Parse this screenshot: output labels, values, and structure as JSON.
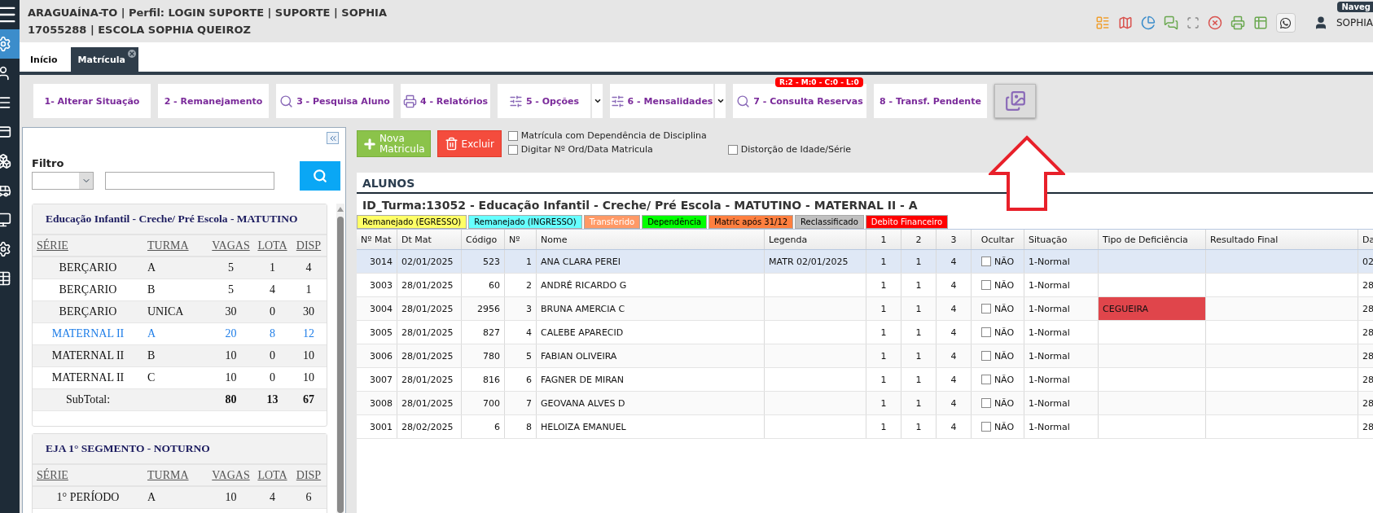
{
  "header": {
    "line1": "ARAGUAÍNA-TO | Perfil: LOGIN SUPORTE | SUPORTE | SOPHIA",
    "line2": "17055288 | ESCOLA SOPHIA QUEIROZ",
    "user": "SOPHIA",
    "badge": "Naveg"
  },
  "sidebar": {
    "items": [
      {
        "selected": true
      },
      {
        "selected": false
      },
      {
        "selected": false
      },
      {
        "selected": false
      },
      {
        "selected": false
      },
      {
        "selected": false
      },
      {
        "selected": false
      },
      {
        "selected": false
      },
      {
        "selected": false
      }
    ]
  },
  "tabs": [
    {
      "label": "Início",
      "selected": false,
      "closable": false
    },
    {
      "label": "Matrícula",
      "selected": true,
      "closable": true
    }
  ],
  "toolbar": {
    "buttons": [
      {
        "kind": "text",
        "label": "1- Alterar Situação"
      },
      {
        "kind": "text",
        "label": "2 - Remanejamento"
      },
      {
        "kind": "text",
        "label": "3 - Pesquisa Aluno"
      },
      {
        "kind": "text",
        "label": "4 - Relatórios"
      },
      {
        "kind": "text",
        "label": "5 - Opções",
        "dropdown": true
      },
      {
        "kind": "text",
        "label": "6 - Mensalidades",
        "dropdown": true
      },
      {
        "kind": "text",
        "label": "7 - Consulta Reservas",
        "badge": "R:2 - M:0 - C:0 - L:0"
      },
      {
        "kind": "text",
        "label": "8 - Transf. Pendente"
      },
      {
        "kind": "icon"
      }
    ]
  },
  "filter": {
    "label": "Filtro"
  },
  "groups": [
    {
      "title": "Educação Infantil - Creche/ Pré Escola - MATUTINO",
      "columns": [
        "SÉRIE",
        "TURMA",
        "VAGAS",
        "LOTA",
        "DISP"
      ],
      "rows": [
        {
          "selected": false,
          "cells": [
            "BERÇARIO",
            "A",
            "5",
            "1",
            "4"
          ]
        },
        {
          "selected": false,
          "cells": [
            "BERÇARIO",
            "B",
            "5",
            "4",
            "1"
          ]
        },
        {
          "selected": false,
          "cells": [
            "BERÇARIO",
            "UNICA",
            "30",
            "0",
            "30"
          ]
        },
        {
          "selected": true,
          "cells": [
            "MATERNAL II",
            "A",
            "20",
            "8",
            "12"
          ]
        },
        {
          "selected": false,
          "cells": [
            "MATERNAL II",
            "B",
            "10",
            "0",
            "10"
          ]
        },
        {
          "selected": false,
          "cells": [
            "MATERNAL II",
            "C",
            "10",
            "0",
            "10"
          ]
        }
      ],
      "subtotal": {
        "label": "SubTotal:",
        "values": [
          "80",
          "13",
          "67"
        ]
      }
    },
    {
      "title": "EJA 1° SEGMENTO - NOTURNO",
      "columns": [
        "SÉRIE",
        "TURMA",
        "VAGAS",
        "LOTA",
        "DISP"
      ],
      "rows": [
        {
          "selected": false,
          "cells": [
            "1° PERÍODO",
            "A",
            "10",
            "4",
            "6"
          ]
        }
      ]
    }
  ],
  "actions": {
    "new_label": "Nova\nMatricula",
    "delete_label": "Excluir",
    "checkboxes": [
      {
        "label": "Matrícula com Dependência de Disciplina",
        "checked": false
      },
      {
        "label": "Digitar Nº Ord/Data Matricula",
        "checked": false
      },
      {
        "label": "Distorção de Idade/Série",
        "checked": false
      }
    ]
  },
  "students": {
    "title": "ALUNOS",
    "class_title": "ID_Turma:13052 - Educação Infantil - Creche/ Pré Escola - MATUTINO - MATERNAL II - A",
    "legend": [
      {
        "label": "Remanejado (EGRESSO)",
        "color": "#ffff66"
      },
      {
        "label": "Remanejado (INGRESSO)",
        "color": "#66ffff"
      },
      {
        "label": "Transferido",
        "color": "#ff9966"
      },
      {
        "label": "Dependência",
        "color": "#00ff00"
      },
      {
        "label": "Matric após 31/12",
        "color": "#ff7f3f"
      },
      {
        "label": "Reclassificado",
        "color": "#c0c0c0"
      },
      {
        "label": "Debito Financeiro",
        "color": "#ff0000"
      }
    ],
    "columns": [
      "Nº Mat",
      "Dt Mat",
      "Código",
      "Nº",
      "Nome",
      "Legenda",
      "1",
      "2",
      "3",
      "Ocultar",
      "Situação",
      "Tipo de Deficiência",
      "Resultado Final",
      "Da"
    ],
    "rows": [
      {
        "selected": true,
        "cells": [
          "3014",
          "02/01/2025",
          "523",
          "1",
          "ANA CLARA PEREI",
          "MATR 02/01/2025",
          "1",
          "1",
          "4",
          {
            "checked": false,
            "label": "NÃO"
          },
          "1-Normal",
          null,
          null,
          "02"
        ]
      },
      {
        "selected": false,
        "cells": [
          "3003",
          "28/01/2025",
          "60",
          "2",
          "ANDRÉ RICARDO G",
          null,
          "1",
          "1",
          "4",
          {
            "checked": false,
            "label": "NÃO"
          },
          "1-Normal",
          null,
          null,
          "28"
        ]
      },
      {
        "selected": false,
        "cells": [
          "3004",
          "28/01/2025",
          "2956",
          "3",
          "BRUNA AMERCIA C",
          null,
          "1",
          "1",
          "4",
          {
            "checked": false,
            "label": "NÃO"
          },
          "1-Normal",
          {
            "text": "CEGUEIRA",
            "color": "#e0454b"
          },
          null,
          "28"
        ]
      },
      {
        "selected": false,
        "cells": [
          "3005",
          "28/01/2025",
          "827",
          "4",
          "CALEBE APARECID",
          null,
          "1",
          "1",
          "4",
          {
            "checked": false,
            "label": "NÃO"
          },
          "1-Normal",
          null,
          null,
          "28"
        ]
      },
      {
        "selected": false,
        "cells": [
          "3006",
          "28/01/2025",
          "780",
          "5",
          "FABIAN OLIVEIRA",
          null,
          "1",
          "1",
          "4",
          {
            "checked": false,
            "label": "NÃO"
          },
          "1-Normal",
          null,
          null,
          "28"
        ]
      },
      {
        "selected": false,
        "cells": [
          "3007",
          "28/01/2025",
          "816",
          "6",
          "FAGNER DE MIRAN",
          null,
          "1",
          "1",
          "4",
          {
            "checked": false,
            "label": "NÃO"
          },
          "1-Normal",
          null,
          null,
          "28"
        ]
      },
      {
        "selected": false,
        "cells": [
          "3008",
          "28/01/2025",
          "700",
          "7",
          "GEOVANA ALVES D",
          null,
          "1",
          "1",
          "4",
          {
            "checked": false,
            "label": "NÃO"
          },
          "1-Normal",
          null,
          null,
          "28"
        ]
      },
      {
        "selected": false,
        "cells": [
          "3001",
          "28/02/2025",
          "6",
          "8",
          "HELOIZA EMANUEL",
          null,
          "1",
          "1",
          "4",
          {
            "checked": false,
            "label": "NÃO"
          },
          "1-Normal",
          null,
          null,
          "28"
        ]
      }
    ]
  }
}
